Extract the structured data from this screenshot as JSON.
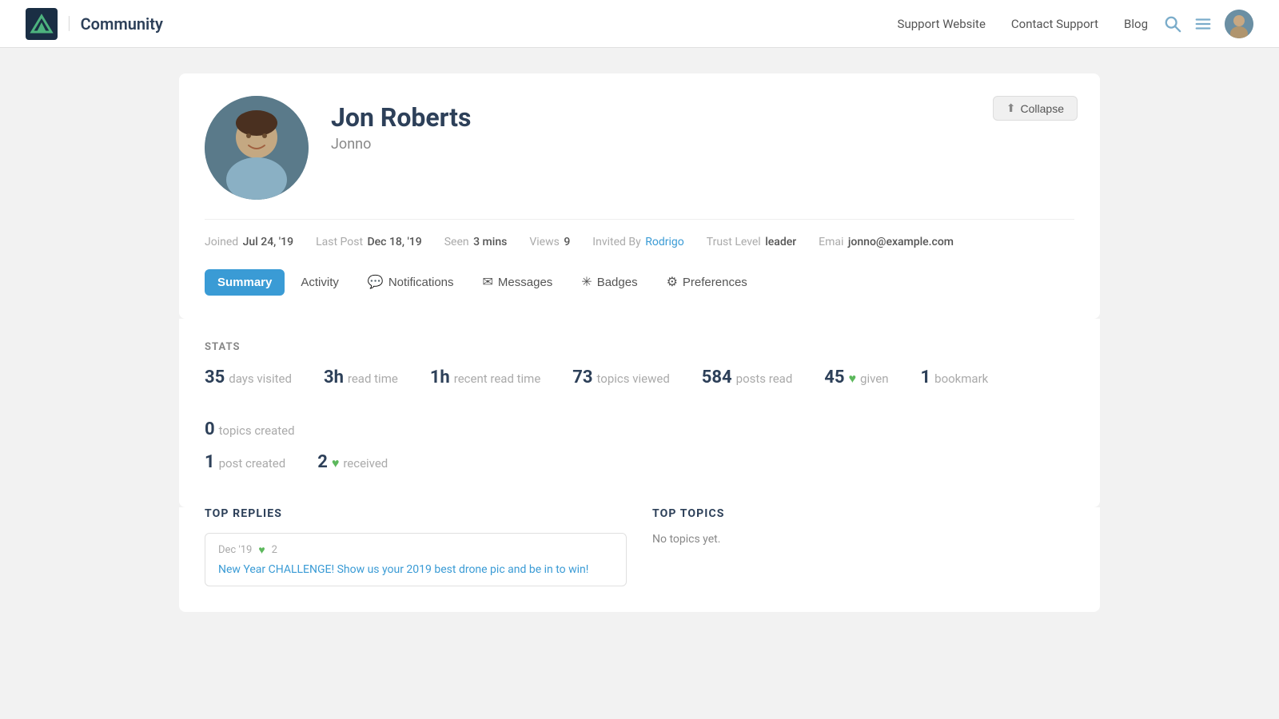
{
  "header": {
    "logo_text": "Community",
    "logo_separator": "|",
    "nav": {
      "support": "Support Website",
      "contact": "Contact Support",
      "blog": "Blog"
    },
    "collapse_btn": "Collapse"
  },
  "profile": {
    "name": "Jon Roberts",
    "username": "Jonno",
    "meta": {
      "joined_label": "Joined",
      "joined_value": "Jul 24, '19",
      "last_post_label": "Last Post",
      "last_post_value": "Dec 18, '19",
      "seen_label": "Seen",
      "seen_value": "3 mins",
      "views_label": "Views",
      "views_value": "9",
      "invited_label": "Invited By",
      "invited_value": "Rodrigo",
      "trust_label": "Trust Level",
      "trust_value": "leader",
      "email_label": "Emai",
      "email_value": "jonno@example.com"
    }
  },
  "tabs": [
    {
      "id": "summary",
      "label": "Summary",
      "icon": "",
      "active": true
    },
    {
      "id": "activity",
      "label": "Activity",
      "icon": "",
      "active": false
    },
    {
      "id": "notifications",
      "label": "Notifications",
      "icon": "💬",
      "active": false
    },
    {
      "id": "messages",
      "label": "Messages",
      "icon": "✉",
      "active": false
    },
    {
      "id": "badges",
      "label": "Badges",
      "icon": "✳",
      "active": false
    },
    {
      "id": "preferences",
      "label": "Preferences",
      "icon": "⚙",
      "active": false
    }
  ],
  "stats": {
    "label": "STATS",
    "items_row1": [
      {
        "number": "35",
        "desc": "days visited"
      },
      {
        "number": "3h",
        "desc": "read time"
      },
      {
        "number": "1h",
        "desc": "recent read time"
      },
      {
        "number": "73",
        "desc": "topics viewed"
      },
      {
        "number": "584",
        "desc": "posts read"
      },
      {
        "number": "45",
        "desc": "given",
        "heart": true
      },
      {
        "number": "1",
        "desc": "bookmark"
      },
      {
        "number": "0",
        "desc": "topics created"
      }
    ],
    "items_row2": [
      {
        "number": "1",
        "desc": "post created"
      },
      {
        "number": "2",
        "desc": "received",
        "heart": true
      }
    ]
  },
  "top_replies": {
    "title": "TOP REPLIES",
    "items": [
      {
        "date": "Dec '19",
        "likes": "2",
        "link": "New Year CHALLENGE! Show us your 2019 best drone pic and be in to win!"
      }
    ]
  },
  "top_topics": {
    "title": "TOP TOPICS",
    "empty": "No topics yet."
  }
}
